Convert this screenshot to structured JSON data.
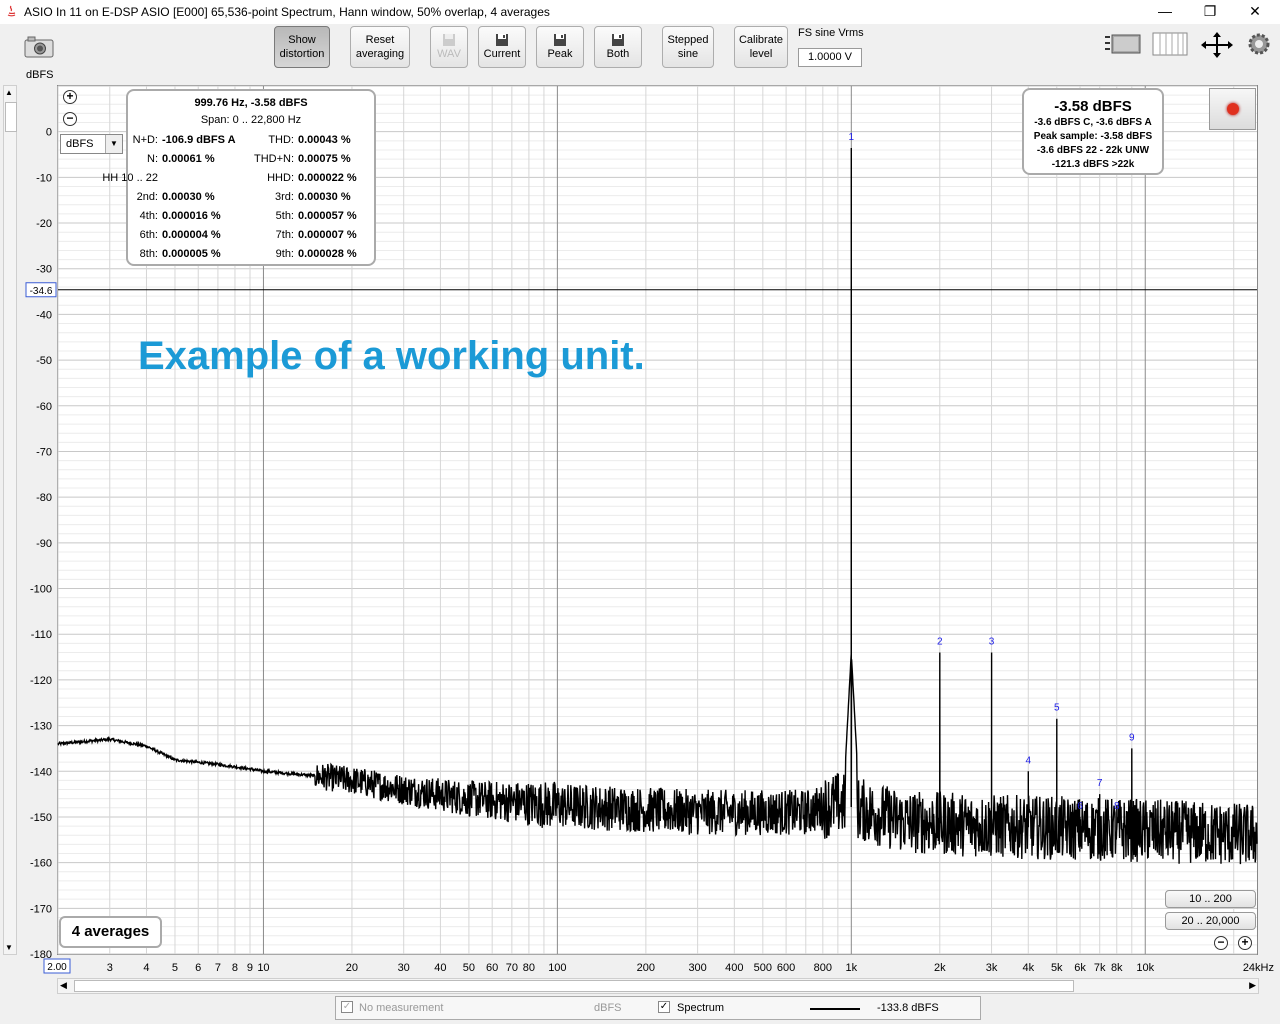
{
  "window": {
    "title": "ASIO In 11 on E-DSP ASIO [E000] 65,536-point Spectrum, Hann window, 50% overlap, 4 averages",
    "minimize": "—",
    "restore": "❐",
    "close": "✕"
  },
  "toolbar": {
    "show_distortion": [
      "Show",
      "distortion"
    ],
    "reset_averaging": [
      "Reset",
      "averaging"
    ],
    "wav": "WAV",
    "current": "Current",
    "peak": "Peak",
    "both": "Both",
    "stepped_sine": [
      "Stepped",
      "sine"
    ],
    "calibrate_level": [
      "Calibrate",
      "level"
    ],
    "fs_label": "FS sine Vrms",
    "fs_value": "1.0000 V"
  },
  "plot": {
    "unit_label": "dBFS",
    "unit_select": "dBFS",
    "cursor_level": "-34.6",
    "x_start_label": "2.00",
    "averages_badge": "4 averages",
    "range_buttons": [
      "10 .. 200",
      "20 .. 20,000"
    ],
    "annotation": "Example of a working unit."
  },
  "info": {
    "header": "999.76 Hz, -3.58 dBFS",
    "span": "Span: 0 .. 22,800 Hz",
    "rows": [
      {
        "l_label": "N+D:",
        "l_value": "-106.9 dBFS A",
        "r_label": "THD:",
        "r_value": "0.00043 %"
      },
      {
        "l_label": "N:",
        "l_value": "0.00061 %",
        "r_label": "THD+N:",
        "r_value": "0.00075 %"
      },
      {
        "l_label": "HH 10 .. 22",
        "l_value": "",
        "r_label": "HHD:",
        "r_value": "0.000022 %"
      },
      {
        "l_label": "2nd:",
        "l_value": "0.00030 %",
        "r_label": "3rd:",
        "r_value": "0.00030 %"
      },
      {
        "l_label": "4th:",
        "l_value": "0.000016 %",
        "r_label": "5th:",
        "r_value": "0.000057 %"
      },
      {
        "l_label": "6th:",
        "l_value": "0.000004 %",
        "r_label": "7th:",
        "r_value": "0.000007 %"
      },
      {
        "l_label": "8th:",
        "l_value": "0.000005 %",
        "r_label": "9th:",
        "r_value": "0.000028 %"
      }
    ]
  },
  "level": {
    "main": "-3.58 dBFS",
    "lines": [
      "-3.6 dBFS C, -3.6 dBFS A",
      "Peak sample: -3.58 dBFS",
      "-3.6 dBFS 22 - 22k UNW",
      "-121.3 dBFS >22k"
    ]
  },
  "legend": {
    "no_measurement": "No measurement",
    "no_measurement_unit": "dBFS",
    "spectrum": "Spectrum",
    "spectrum_value": "-133.8 dBFS"
  },
  "chart_data": {
    "type": "line",
    "xscale": "log",
    "xlim": [
      2,
      24000
    ],
    "ylim": [
      -180,
      10
    ],
    "yticks": [
      0,
      -10,
      -20,
      -30,
      -40,
      -50,
      -60,
      -70,
      -80,
      -90,
      -100,
      -110,
      -120,
      -130,
      -140,
      -150,
      -160,
      -170,
      -180
    ],
    "ylabel": "dBFS",
    "xticks": [
      {
        "v": 3,
        "l": "3"
      },
      {
        "v": 4,
        "l": "4"
      },
      {
        "v": 5,
        "l": "5"
      },
      {
        "v": 6,
        "l": "6"
      },
      {
        "v": 7,
        "l": "7"
      },
      {
        "v": 8,
        "l": "8"
      },
      {
        "v": 9,
        "l": "9"
      },
      {
        "v": 10,
        "l": "10"
      },
      {
        "v": 20,
        "l": "20"
      },
      {
        "v": 30,
        "l": "30"
      },
      {
        "v": 40,
        "l": "40"
      },
      {
        "v": 50,
        "l": "50"
      },
      {
        "v": 60,
        "l": "60"
      },
      {
        "v": 70,
        "l": "70"
      },
      {
        "v": 80,
        "l": "80"
      },
      {
        "v": 100,
        "l": "100"
      },
      {
        "v": 200,
        "l": "200"
      },
      {
        "v": 300,
        "l": "300"
      },
      {
        "v": 400,
        "l": "400"
      },
      {
        "v": 500,
        "l": "500"
      },
      {
        "v": 600,
        "l": "600"
      },
      {
        "v": 800,
        "l": "800"
      },
      {
        "v": 1000,
        "l": "1k"
      },
      {
        "v": 2000,
        "l": "2k"
      },
      {
        "v": 3000,
        "l": "3k"
      },
      {
        "v": 4000,
        "l": "4k"
      },
      {
        "v": 5000,
        "l": "5k"
      },
      {
        "v": 6000,
        "l": "6k"
      },
      {
        "v": 7000,
        "l": "7k"
      },
      {
        "v": 8000,
        "l": "8k"
      },
      {
        "v": 10000,
        "l": "10k"
      },
      {
        "v": 24000,
        "l": "24kHz"
      }
    ],
    "cursor_db": -34.6,
    "harmonics": [
      {
        "label": "1",
        "f": 999.76,
        "db": -3.58
      },
      {
        "label": "2",
        "f": 2000,
        "db": -114
      },
      {
        "label": "3",
        "f": 3000,
        "db": -114
      },
      {
        "label": "4",
        "f": 4000,
        "db": -140
      },
      {
        "label": "5",
        "f": 5000,
        "db": -128.5
      },
      {
        "label": "6",
        "f": 6000,
        "db": -150
      },
      {
        "label": "7",
        "f": 7000,
        "db": -145
      },
      {
        "label": "8",
        "f": 8000,
        "db": -150
      },
      {
        "label": "9",
        "f": 9000,
        "db": -135
      }
    ],
    "spectrum_envelope": [
      [
        2,
        -134
      ],
      [
        3,
        -133
      ],
      [
        4,
        -134.5
      ],
      [
        5,
        -137.5
      ],
      [
        7,
        -138.5
      ],
      [
        9,
        -139.5
      ],
      [
        10,
        -140
      ],
      [
        15,
        -141
      ],
      [
        20,
        -142
      ],
      [
        30,
        -144
      ],
      [
        50,
        -146
      ],
      [
        100,
        -147.5
      ],
      [
        300,
        -149
      ],
      [
        700,
        -149
      ],
      [
        900,
        -147
      ],
      [
        1500,
        -151
      ],
      [
        3000,
        -152
      ],
      [
        10000,
        -153
      ],
      [
        24000,
        -154
      ]
    ],
    "spectrum_color": "#000000",
    "harmonic_label_color": "#1a1ae6"
  }
}
